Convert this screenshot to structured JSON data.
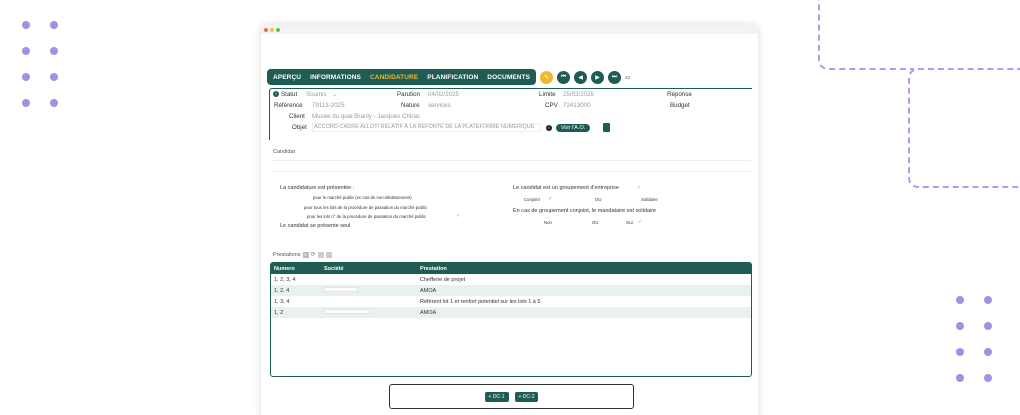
{
  "colors": {
    "accent": "#1f5c53",
    "active_tab": "#f2b632",
    "decor": "#9d93e6"
  },
  "tabs": [
    {
      "label": "APERÇU"
    },
    {
      "label": "INFORMATIONS"
    },
    {
      "label": "CANDIDATURE",
      "active": true
    },
    {
      "label": "PLANIFICATION"
    },
    {
      "label": "DOCUMENTS"
    }
  ],
  "nav": {
    "page_count": "42"
  },
  "info": {
    "statut_label": "Statut",
    "statut_value": "Soumis",
    "parution_label": "Parution",
    "parution_value": "04/02/2025",
    "limite_label": "Limite",
    "limite_value": "25/03/2025",
    "reponse_label": "Réponse",
    "reference_label": "Référence",
    "reference_value": "79113-2025",
    "nature_label": "Nature",
    "nature_value": "services",
    "cpv_label": "CPV",
    "cpv_value": "72413000",
    "budget_label": "Budget",
    "client_label": "Client",
    "client_value": "Musée du quai Branly - Jacques Chirac",
    "objet_label": "Objet",
    "objet_value": "ACCORD-CADRE ALLOTI RELATIF À LA REFONTE DE LA PLATEFORME NUMÉRIQUE",
    "voir_label": "Voir l'A.O."
  },
  "candidat": {
    "title": "Candidat",
    "presentee": "La candidature est présentée :",
    "opt1": "pour le marché public (en cas de non-allotissement)",
    "opt2": "pour tous les lots de la procédure de passation du marché public",
    "opt3": "pour les lots n° de la procédure de passation du marché public",
    "seul": "Le candidat se présente seul",
    "groupement": "Le candidat est un groupement d'entreprise",
    "conjoint": "Conjoint",
    "ou1": "OU",
    "solidaire": "Solidaire",
    "mandataire": "En cas de groupement conjoint, le mandataire est solidaire",
    "non": "Non",
    "ou2": "OU",
    "oui": "Oui"
  },
  "prestations": {
    "title": "Prestations",
    "count": "0",
    "columns": [
      "Numero",
      "Société",
      "Prestation"
    ],
    "rows": [
      {
        "numero": "1, 2, 3, 4",
        "prestation": "Chefferie de projet"
      },
      {
        "numero": "1, 2, 4",
        "prestation": "AMOA"
      },
      {
        "numero": "1, 3, 4",
        "prestation": "Référent lot 1 et renfort potentiel sur les lots 1 à 5"
      },
      {
        "numero": "1, 2",
        "prestation": "AMOA"
      }
    ]
  },
  "footer": {
    "dc1": "+ DC-1",
    "dc2": "+ DC-2"
  }
}
